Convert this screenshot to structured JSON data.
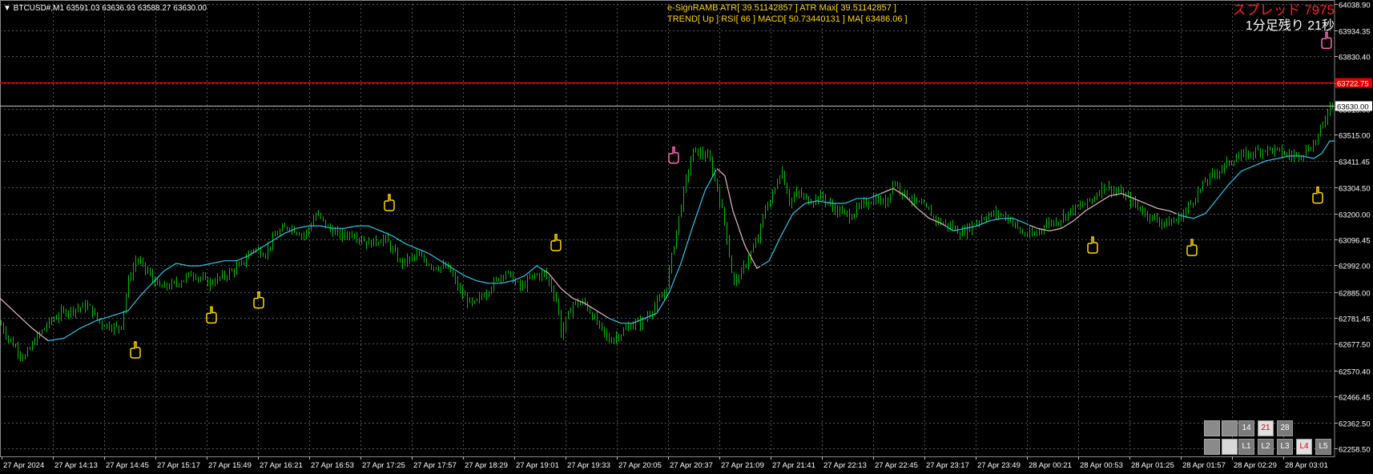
{
  "header": {
    "symbol_info": "▼ BTCUSD#,M1  63591.03 63636.93 63588.27 63630.00",
    "indicator_line1": "e-SignRAMB  ATR[ 39.51142857 ] ATR Max[ 39.51142857 ]",
    "indicator_line2": "TREND[ Up ] RSI[ 66 ] MACD[ 50.73440131 ] MA[ 63486.06 ]",
    "spread": "スプレッド 7975",
    "remaining": "1分足残り 21秒"
  },
  "colors": {
    "background": "#000000",
    "grid": "#55555f",
    "candles": "#00c000",
    "ma_up": "#29c8ee",
    "ma_down": "#e8b8c4",
    "ask_line": "#e00000",
    "bid_line": "#c0c0c0",
    "arrow_up": "#ffd700",
    "arrow_down": "#ff69b4",
    "text": "#ffffff"
  },
  "chart_data": {
    "type": "candlestick",
    "symbol": "BTCUSD#",
    "timeframe": "M1",
    "ylim": [
      62258.5,
      64038.9
    ],
    "y_ticks": [
      "64038.90",
      "63934.35",
      "63830.40",
      "63722.75",
      "63618.00",
      "63515.00",
      "63411.45",
      "63304.50",
      "63200.00",
      "63096.45",
      "62992.00",
      "62885.00",
      "62781.45",
      "62677.50",
      "62570.40",
      "62466.45",
      "62362.50",
      "62258.50"
    ],
    "x_ticks": [
      "27 Apr 2024",
      "27 Apr 14:13",
      "27 Apr 14:45",
      "27 Apr 15:17",
      "27 Apr 15:49",
      "27 Apr 16:21",
      "27 Apr 16:53",
      "27 Apr 17:25",
      "27 Apr 17:57",
      "27 Apr 18:29",
      "27 Apr 19:01",
      "27 Apr 19:33",
      "27 Apr 20:05",
      "27 Apr 20:37",
      "27 Apr 21:09",
      "27 Apr 21:41",
      "27 Apr 22:13",
      "27 Apr 22:45",
      "27 Apr 23:17",
      "27 Apr 23:49",
      "28 Apr 00:21",
      "28 Apr 00:53",
      "28 Apr 01:25",
      "28 Apr 01:57",
      "28 Apr 02:29",
      "28 Apr 03:01"
    ],
    "price_keypoints": [
      [
        0,
        62760
      ],
      [
        10,
        62700
      ],
      [
        20,
        62660
      ],
      [
        30,
        62620
      ],
      [
        45,
        62700
      ],
      [
        60,
        62760
      ],
      [
        75,
        62800
      ],
      [
        95,
        62820
      ],
      [
        110,
        62830
      ],
      [
        125,
        62760
      ],
      [
        150,
        62740
      ],
      [
        160,
        62930
      ],
      [
        170,
        63020
      ],
      [
        185,
        62960
      ],
      [
        200,
        62900
      ],
      [
        220,
        62920
      ],
      [
        240,
        62960
      ],
      [
        260,
        62920
      ],
      [
        280,
        62950
      ],
      [
        300,
        62990
      ],
      [
        315,
        63060
      ],
      [
        330,
        63040
      ],
      [
        345,
        63120
      ],
      [
        360,
        63150
      ],
      [
        380,
        63110
      ],
      [
        395,
        63200
      ],
      [
        410,
        63140
      ],
      [
        425,
        63110
      ],
      [
        440,
        63120
      ],
      [
        460,
        63080
      ],
      [
        480,
        63100
      ],
      [
        500,
        63000
      ],
      [
        520,
        63030
      ],
      [
        540,
        62990
      ],
      [
        560,
        62980
      ],
      [
        575,
        62880
      ],
      [
        590,
        62830
      ],
      [
        610,
        62900
      ],
      [
        630,
        62970
      ],
      [
        650,
        62900
      ],
      [
        665,
        62950
      ],
      [
        680,
        62960
      ],
      [
        695,
        62850
      ],
      [
        700,
        62720
      ],
      [
        715,
        62840
      ],
      [
        730,
        62840
      ],
      [
        745,
        62760
      ],
      [
        760,
        62690
      ],
      [
        775,
        62720
      ],
      [
        790,
        62760
      ],
      [
        800,
        62760
      ],
      [
        815,
        62820
      ],
      [
        830,
        62880
      ],
      [
        845,
        63150
      ],
      [
        855,
        63320
      ],
      [
        865,
        63450
      ],
      [
        875,
        63440
      ],
      [
        885,
        63420
      ],
      [
        895,
        63300
      ],
      [
        905,
        63150
      ],
      [
        915,
        62920
      ],
      [
        925,
        62960
      ],
      [
        935,
        63030
      ],
      [
        945,
        63090
      ],
      [
        955,
        63220
      ],
      [
        965,
        63280
      ],
      [
        975,
        63380
      ],
      [
        985,
        63250
      ],
      [
        995,
        63280
      ],
      [
        1010,
        63250
      ],
      [
        1025,
        63270
      ],
      [
        1040,
        63220
      ],
      [
        1060,
        63190
      ],
      [
        1075,
        63230
      ],
      [
        1090,
        63260
      ],
      [
        1105,
        63240
      ],
      [
        1115,
        63330
      ],
      [
        1125,
        63290
      ],
      [
        1140,
        63250
      ],
      [
        1155,
        63220
      ],
      [
        1170,
        63170
      ],
      [
        1185,
        63150
      ],
      [
        1200,
        63120
      ],
      [
        1215,
        63160
      ],
      [
        1230,
        63190
      ],
      [
        1245,
        63200
      ],
      [
        1260,
        63180
      ],
      [
        1275,
        63120
      ],
      [
        1290,
        63110
      ],
      [
        1305,
        63160
      ],
      [
        1320,
        63170
      ],
      [
        1335,
        63210
      ],
      [
        1350,
        63230
      ],
      [
        1365,
        63260
      ],
      [
        1375,
        63310
      ],
      [
        1385,
        63300
      ],
      [
        1400,
        63280
      ],
      [
        1415,
        63240
      ],
      [
        1430,
        63200
      ],
      [
        1445,
        63170
      ],
      [
        1460,
        63160
      ],
      [
        1475,
        63190
      ],
      [
        1490,
        63260
      ],
      [
        1505,
        63330
      ],
      [
        1520,
        63370
      ],
      [
        1540,
        63420
      ],
      [
        1560,
        63440
      ],
      [
        1580,
        63460
      ],
      [
        1595,
        63450
      ],
      [
        1610,
        63430
      ],
      [
        1625,
        63440
      ],
      [
        1640,
        63480
      ],
      [
        1652,
        63560
      ],
      [
        1660,
        63640
      ]
    ],
    "ma_keypoints": [
      [
        0,
        62860
      ],
      [
        20,
        62800
      ],
      [
        40,
        62740
      ],
      [
        60,
        62690
      ],
      [
        80,
        62700
      ],
      [
        100,
        62740
      ],
      [
        120,
        62770
      ],
      [
        140,
        62790
      ],
      [
        160,
        62810
      ],
      [
        175,
        62870
      ],
      [
        190,
        62920
      ],
      [
        205,
        62970
      ],
      [
        220,
        63000
      ],
      [
        235,
        62990
      ],
      [
        250,
        62990
      ],
      [
        265,
        63000
      ],
      [
        280,
        63010
      ],
      [
        295,
        63010
      ],
      [
        310,
        63030
      ],
      [
        325,
        63060
      ],
      [
        340,
        63090
      ],
      [
        355,
        63120
      ],
      [
        370,
        63140
      ],
      [
        385,
        63150
      ],
      [
        400,
        63150
      ],
      [
        415,
        63140
      ],
      [
        430,
        63140
      ],
      [
        445,
        63150
      ],
      [
        460,
        63150
      ],
      [
        475,
        63130
      ],
      [
        490,
        63110
      ],
      [
        505,
        63080
      ],
      [
        520,
        63060
      ],
      [
        535,
        63040
      ],
      [
        550,
        63010
      ],
      [
        565,
        62980
      ],
      [
        580,
        62950
      ],
      [
        595,
        62930
      ],
      [
        610,
        62920
      ],
      [
        625,
        62920
      ],
      [
        640,
        62930
      ],
      [
        655,
        62950
      ],
      [
        670,
        62990
      ],
      [
        685,
        62960
      ],
      [
        700,
        62900
      ],
      [
        715,
        62860
      ],
      [
        730,
        62840
      ],
      [
        745,
        62810
      ],
      [
        760,
        62780
      ],
      [
        775,
        62760
      ],
      [
        790,
        62760
      ],
      [
        805,
        62780
      ],
      [
        820,
        62800
      ],
      [
        835,
        62880
      ],
      [
        850,
        63000
      ],
      [
        865,
        63150
      ],
      [
        880,
        63290
      ],
      [
        895,
        63380
      ],
      [
        905,
        63350
      ],
      [
        915,
        63210
      ],
      [
        930,
        63070
      ],
      [
        945,
        62980
      ],
      [
        960,
        63010
      ],
      [
        975,
        63110
      ],
      [
        990,
        63200
      ],
      [
        1005,
        63240
      ],
      [
        1020,
        63250
      ],
      [
        1040,
        63240
      ],
      [
        1055,
        63240
      ],
      [
        1070,
        63260
      ],
      [
        1085,
        63260
      ],
      [
        1100,
        63280
      ],
      [
        1115,
        63300
      ],
      [
        1130,
        63270
      ],
      [
        1145,
        63220
      ],
      [
        1160,
        63180
      ],
      [
        1175,
        63160
      ],
      [
        1190,
        63130
      ],
      [
        1205,
        63140
      ],
      [
        1220,
        63150
      ],
      [
        1235,
        63170
      ],
      [
        1250,
        63180
      ],
      [
        1265,
        63180
      ],
      [
        1280,
        63160
      ],
      [
        1295,
        63140
      ],
      [
        1310,
        63130
      ],
      [
        1325,
        63140
      ],
      [
        1340,
        63170
      ],
      [
        1355,
        63210
      ],
      [
        1370,
        63240
      ],
      [
        1385,
        63270
      ],
      [
        1400,
        63280
      ],
      [
        1415,
        63260
      ],
      [
        1430,
        63240
      ],
      [
        1445,
        63220
      ],
      [
        1460,
        63210
      ],
      [
        1475,
        63190
      ],
      [
        1490,
        63180
      ],
      [
        1505,
        63200
      ],
      [
        1520,
        63260
      ],
      [
        1535,
        63320
      ],
      [
        1550,
        63370
      ],
      [
        1565,
        63390
      ],
      [
        1580,
        63410
      ],
      [
        1595,
        63420
      ],
      [
        1610,
        63430
      ],
      [
        1625,
        63430
      ],
      [
        1640,
        63420
      ],
      [
        1650,
        63440
      ],
      [
        1660,
        63490
      ]
    ],
    "ma_segments": [
      {
        "from": 0,
        "to": 60,
        "trend": "down"
      },
      {
        "from": 60,
        "to": 680,
        "trend": "up"
      },
      {
        "from": 680,
        "to": 760,
        "trend": "down"
      },
      {
        "from": 760,
        "to": 895,
        "trend": "up"
      },
      {
        "from": 895,
        "to": 950,
        "trend": "down"
      },
      {
        "from": 950,
        "to": 1100,
        "trend": "up"
      },
      {
        "from": 1100,
        "to": 1180,
        "trend": "down"
      },
      {
        "from": 1180,
        "to": 1285,
        "trend": "up"
      },
      {
        "from": 1285,
        "to": 1470,
        "trend": "down"
      },
      {
        "from": 1470,
        "to": 1666,
        "trend": "up"
      }
    ],
    "current_bid": 63630.0,
    "ask_line": 63722.75,
    "signals": [
      {
        "dir": "up",
        "bar": 169,
        "price": 62650
      },
      {
        "dir": "up",
        "bar": 264,
        "price": 62790
      },
      {
        "dir": "up",
        "bar": 323,
        "price": 62850
      },
      {
        "dir": "up",
        "bar": 486,
        "price": 63240
      },
      {
        "dir": "up",
        "bar": 694,
        "price": 63080
      },
      {
        "dir": "down",
        "bar": 841,
        "price": 63430
      },
      {
        "dir": "up",
        "bar": 1364,
        "price": 63070
      },
      {
        "dir": "up",
        "bar": 1488,
        "price": 63060
      },
      {
        "dir": "up",
        "bar": 1645,
        "price": 63270
      },
      {
        "dir": "down",
        "bar": 1656,
        "price": 63890
      }
    ]
  },
  "controls": {
    "tf_buttons": [
      "14",
      "21",
      "28"
    ],
    "tf_active": "21",
    "level_buttons": [
      "L1",
      "L2",
      "L3",
      "L4",
      "L5"
    ],
    "level_active": "L4"
  }
}
